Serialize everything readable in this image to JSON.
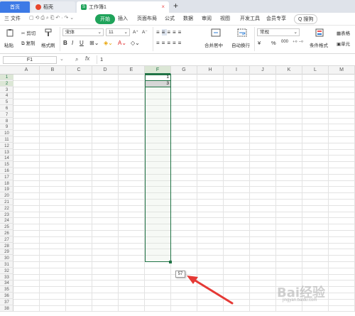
{
  "tabs": {
    "home": "首页",
    "docer": "稻壳",
    "workbook": "工作簿1",
    "workbook_icon": "S",
    "close_glyph": "×",
    "add_glyph": "+"
  },
  "menu": {
    "file": "三 文件",
    "items": [
      "开始",
      "插入",
      "页面布局",
      "公式",
      "数据",
      "审阅",
      "视图",
      "开发工具",
      "会员专享"
    ],
    "search": "Q 搜狗"
  },
  "ribbon": {
    "paste": "粘贴",
    "cut": "剪切",
    "copy": "复制",
    "format_painter": "格式刷",
    "font_name": "宋体",
    "font_size": "11",
    "font_grow": "A⁺",
    "font_shrink": "A⁻",
    "bold": "B",
    "italic": "I",
    "underline": "U",
    "merge_center": "合并居中",
    "wrap_text": "自动换行",
    "number_format": "常规",
    "currency": "¥",
    "percent": "%",
    "thousands": "000",
    "conditional_format": "条件格式",
    "table_style": "表格",
    "cell_style": "单元"
  },
  "formula_bar": {
    "name_box": "F1",
    "zoom_icon": "search-icon",
    "fx_label": "fx",
    "value": "1"
  },
  "columns": [
    "A",
    "B",
    "C",
    "D",
    "E",
    "F",
    "G",
    "H",
    "I",
    "J",
    "K",
    "L",
    "M"
  ],
  "rows": [
    "1",
    "2",
    "3",
    "4",
    "5",
    "6",
    "7",
    "8",
    "9",
    "10",
    "11",
    "12",
    "13",
    "14",
    "15",
    "16",
    "17",
    "18",
    "19",
    "20",
    "21",
    "22",
    "23",
    "24",
    "25",
    "26",
    "27",
    "28",
    "29",
    "30",
    "31",
    "32",
    "33",
    "34",
    "35",
    "36",
    "37",
    "38"
  ],
  "cells": {
    "F1": "1",
    "F2": "3"
  },
  "fill_tooltip": "57",
  "watermark": "Bai经验",
  "watermark_sub": "jingyan.baidu.com",
  "colors": {
    "accent_green": "#217346",
    "start_tab": "#1fa35a",
    "home_tab": "#3d7ae6",
    "arrow": "#e53935"
  }
}
